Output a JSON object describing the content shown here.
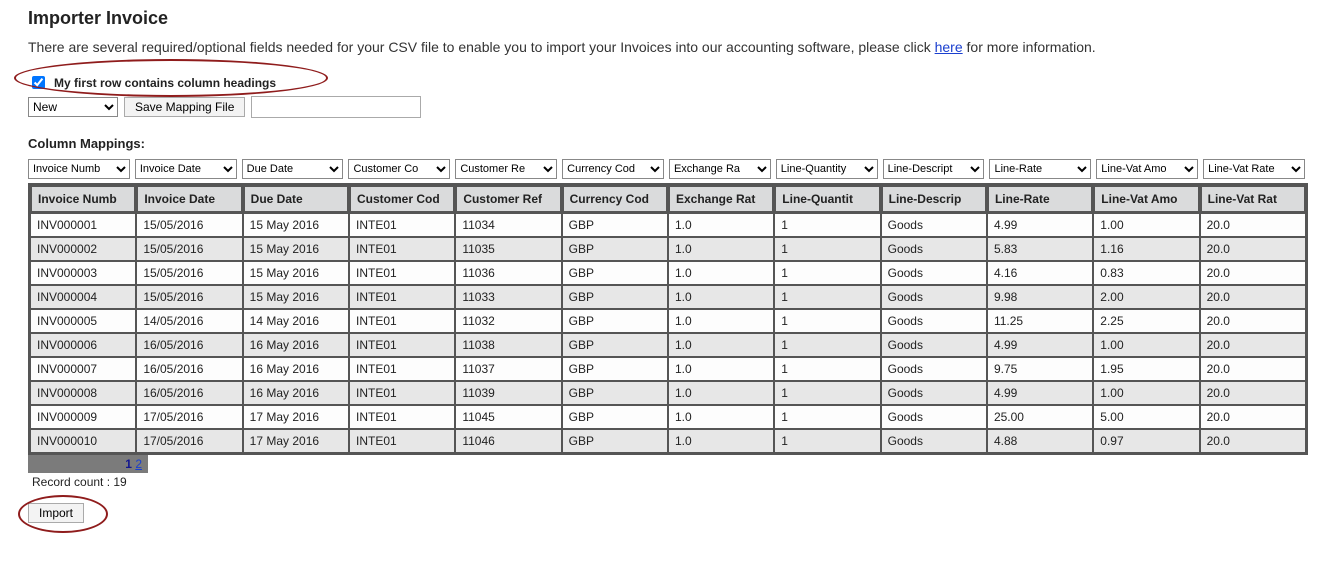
{
  "title": "Importer Invoice",
  "intro_pre": "There are several required/optional fields needed for your CSV file to enable you to import your Invoices into our accounting software, please click ",
  "intro_link": "here",
  "intro_post": " for more information.",
  "first_row_label": "My first row contains column headings",
  "first_row_checked": true,
  "mapping_select_value": "New",
  "save_mapping_label": "Save Mapping File",
  "mapping_name_value": "",
  "column_mappings_label": "Column Mappings:",
  "mapping_dropdowns": [
    "Invoice Numb",
    "Invoice Date",
    "Due Date",
    "Customer Co",
    "Customer Re",
    "Currency Cod",
    "Exchange Ra",
    "Line-Quantity",
    "Line-Descript",
    "Line-Rate",
    "Line-Vat Amo",
    "Line-Vat Rate"
  ],
  "headers": [
    "Invoice Numb",
    "Invoice Date",
    "Due Date",
    "Customer Cod",
    "Customer Ref",
    "Currency Cod",
    "Exchange Rat",
    "Line-Quantit",
    "Line-Descrip",
    "Line-Rate",
    "Line-Vat Amo",
    "Line-Vat Rat"
  ],
  "rows": [
    [
      "INV000001",
      "15/05/2016",
      "15 May 2016",
      "INTE01",
      "11034",
      "GBP",
      "1.0",
      "1",
      "Goods",
      "4.99",
      "1.00",
      "20.0"
    ],
    [
      "INV000002",
      "15/05/2016",
      "15 May 2016",
      "INTE01",
      "11035",
      "GBP",
      "1.0",
      "1",
      "Goods",
      "5.83",
      "1.16",
      "20.0"
    ],
    [
      "INV000003",
      "15/05/2016",
      "15 May 2016",
      "INTE01",
      "11036",
      "GBP",
      "1.0",
      "1",
      "Goods",
      "4.16",
      "0.83",
      "20.0"
    ],
    [
      "INV000004",
      "15/05/2016",
      "15 May 2016",
      "INTE01",
      "11033",
      "GBP",
      "1.0",
      "1",
      "Goods",
      "9.98",
      "2.00",
      "20.0"
    ],
    [
      "INV000005",
      "14/05/2016",
      "14 May 2016",
      "INTE01",
      "11032",
      "GBP",
      "1.0",
      "1",
      "Goods",
      "11.25",
      "2.25",
      "20.0"
    ],
    [
      "INV000006",
      "16/05/2016",
      "16 May 2016",
      "INTE01",
      "11038",
      "GBP",
      "1.0",
      "1",
      "Goods",
      "4.99",
      "1.00",
      "20.0"
    ],
    [
      "INV000007",
      "16/05/2016",
      "16 May 2016",
      "INTE01",
      "11037",
      "GBP",
      "1.0",
      "1",
      "Goods",
      "9.75",
      "1.95",
      "20.0"
    ],
    [
      "INV000008",
      "16/05/2016",
      "16 May 2016",
      "INTE01",
      "11039",
      "GBP",
      "1.0",
      "1",
      "Goods",
      "4.99",
      "1.00",
      "20.0"
    ],
    [
      "INV000009",
      "17/05/2016",
      "17 May 2016",
      "INTE01",
      "11045",
      "GBP",
      "1.0",
      "1",
      "Goods",
      "25.00",
      "5.00",
      "20.0"
    ],
    [
      "INV000010",
      "17/05/2016",
      "17 May 2016",
      "INTE01",
      "11046",
      "GBP",
      "1.0",
      "1",
      "Goods",
      "4.88",
      "0.97",
      "20.0"
    ]
  ],
  "pager_current": "1",
  "pager_next": "2",
  "record_count_label": "Record count : 19",
  "import_label": "Import"
}
